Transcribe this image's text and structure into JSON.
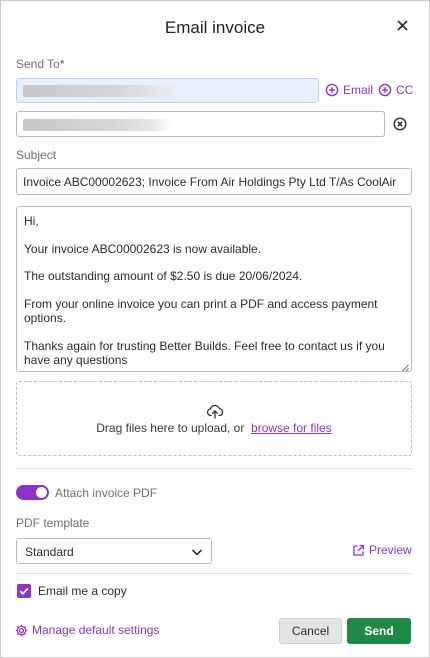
{
  "dialog": {
    "title": "Email invoice"
  },
  "send_to": {
    "label": "Send To",
    "required_mark": "*",
    "email_label": "Email",
    "cc_label": "CC"
  },
  "subject": {
    "label": "Subject",
    "value": "Invoice ABC00002623; Invoice From Air Holdings Pty Ltd T/As CoolAir"
  },
  "message": {
    "lines": [
      "Hi,",
      "Your invoice ABC00002623 is now available.",
      "The outstanding amount of $2.50 is due 20/06/2024.",
      "From your online invoice you can print a PDF and access payment options.",
      "Thanks again for trusting Better Builds. Feel free to contact us if you have any questions"
    ]
  },
  "upload": {
    "text": "Drag files here to upload, or",
    "browse_label": "browse for files"
  },
  "attach_pdf": {
    "label": "Attach invoice PDF",
    "enabled": true
  },
  "pdf_template": {
    "label": "PDF template",
    "selected": "Standard",
    "preview_label": "Preview"
  },
  "email_copy": {
    "label": "Email me a copy",
    "checked": true
  },
  "footer": {
    "manage_label": "Manage default settings",
    "cancel_label": "Cancel",
    "send_label": "Send"
  },
  "colors": {
    "accent": "#8a34c9",
    "send_button": "#1f8a47",
    "active_field": "#e8f0fe"
  }
}
